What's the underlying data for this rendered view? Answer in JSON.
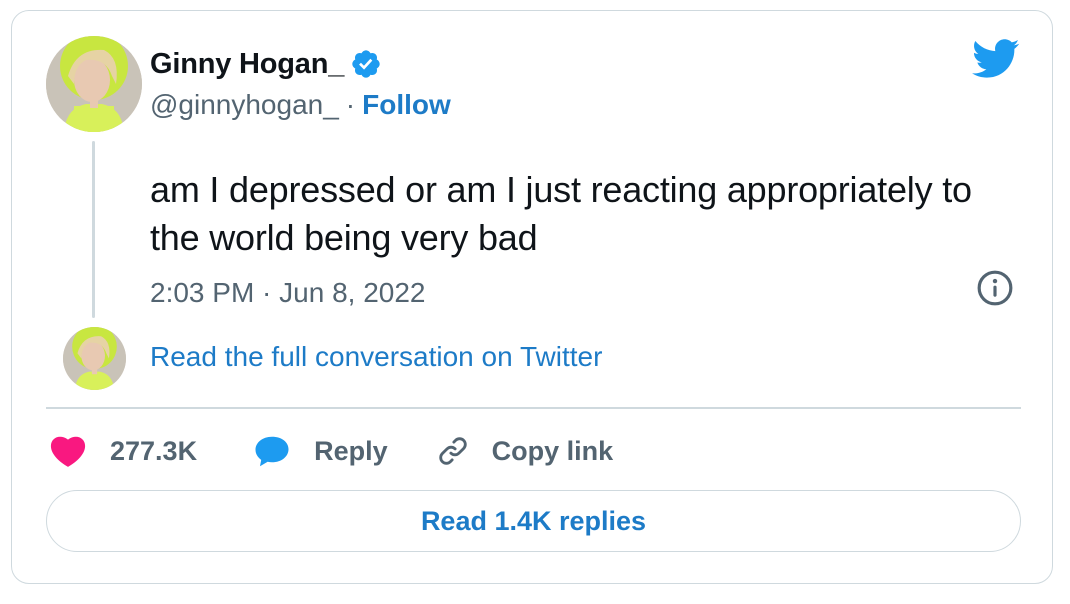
{
  "colors": {
    "accent": "#1d7bc7",
    "twitter_blue": "#1d9bf0",
    "text": "#0f1419",
    "muted": "#536471",
    "border": "#cfd9de",
    "like": "#f91880"
  },
  "author": {
    "name": "Ginny Hogan_",
    "handle": "@ginnyhogan_",
    "separator": "·",
    "follow_label": "Follow",
    "verified_icon": "verified-badge-icon",
    "avatar_icon": "profile-avatar"
  },
  "tweet": {
    "text": "am I depressed or am I just reacting appropriately to the world being very bad",
    "timestamp": "2:03 PM · Jun 8, 2022"
  },
  "thread": {
    "read_conversation_label": "Read the full conversation on Twitter"
  },
  "actions": {
    "like_count": "277.3K",
    "reply_label": "Reply",
    "copy_link_label": "Copy link",
    "like_icon": "heart-icon",
    "reply_icon": "speech-bubble-icon",
    "copy_icon": "link-icon"
  },
  "footer": {
    "read_replies_label": "Read 1.4K replies"
  },
  "icons": {
    "brand": "twitter-bird-icon",
    "info": "info-icon"
  }
}
